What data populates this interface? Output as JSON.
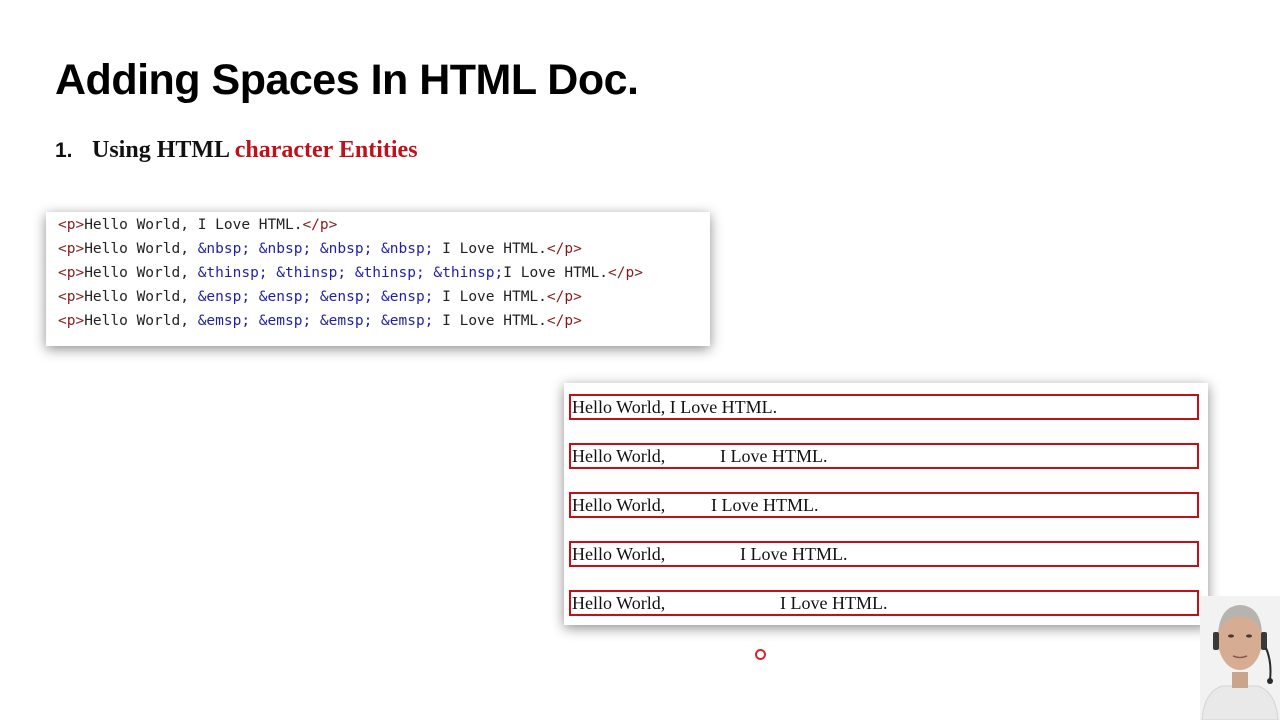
{
  "title": "Adding Spaces In HTML Doc.",
  "list": {
    "number": "1.",
    "text": "Using HTML",
    "highlight": "character Entities",
    "highlight_color": "#c0101a"
  },
  "code": {
    "lines": [
      [
        "<p>",
        "Hello World, I Love HTML.",
        "</p>"
      ],
      [
        "<p>",
        "Hello World, ",
        "&nbsp; &nbsp; &nbsp; &nbsp;",
        " I Love HTML.",
        "</p>"
      ],
      [
        "<p>",
        "Hello World, ",
        "&thinsp; &thinsp; &thinsp; &thinsp;",
        "I Love HTML.",
        "</p>"
      ],
      [
        "<p>",
        "Hello World, ",
        "&ensp; &ensp; &ensp; &ensp;",
        " I Love HTML.",
        "</p>"
      ],
      [
        "<p>",
        "Hello World, ",
        "&emsp; &emsp; &emsp; &emsp;",
        " I Love HTML.",
        "</p>"
      ]
    ],
    "tag_color": "#8b1a1a",
    "entity_color": "#1f1fa8"
  },
  "output": {
    "rows": [
      {
        "left": "Hello World, I Love HTML.",
        "right": ""
      },
      {
        "left": "Hello World,",
        "right": "I Love HTML."
      },
      {
        "left": "Hello World,",
        "right": "I Love HTML."
      },
      {
        "left": "Hello World,",
        "right": "I Love HTML."
      },
      {
        "left": "Hello World,",
        "right": "I Love HTML."
      }
    ],
    "border_color": "#c0101a"
  },
  "webcam": {
    "icon": "presenter-avatar-icon"
  }
}
